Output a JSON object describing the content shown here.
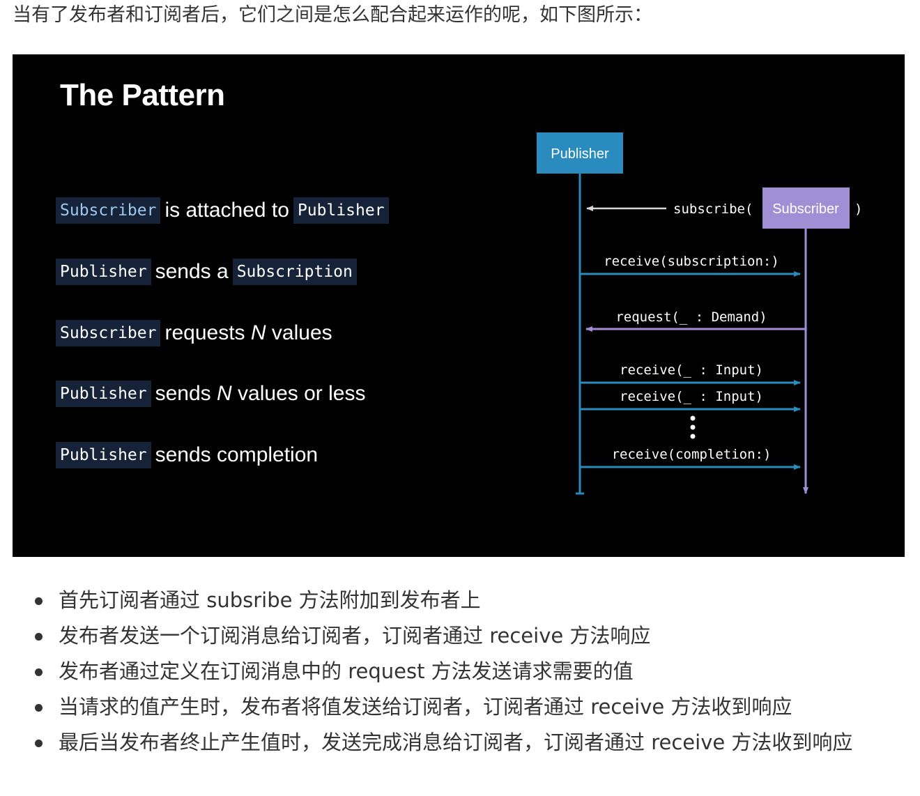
{
  "intro": "当有了发布者和订阅者后，它们之间是怎么配合起来运作的呢，如下图所示：",
  "slide": {
    "title": "The Pattern",
    "steps": [
      {
        "code1": "Subscriber",
        "text": "is attached to",
        "code2": "Publisher"
      },
      {
        "code1": "Publisher",
        "text": "sends a",
        "code2": "Subscription"
      },
      {
        "code1": "Subscriber",
        "text_pre": "requests",
        "text_em": "N",
        "text_post": "values"
      },
      {
        "code1": "Publisher",
        "text_pre": "sends",
        "text_em": "N",
        "text_post": "values or less"
      },
      {
        "code1": "Publisher",
        "text": "sends completion"
      }
    ],
    "diagram": {
      "publisher_label": "Publisher",
      "subscriber_label": "Subscriber",
      "subscribe_open": "subscribe(",
      "subscribe_close": ")",
      "messages": [
        "receive(subscription:)",
        "request(_ : Demand)",
        "receive(_ : Input)",
        "receive(_ : Input)",
        "receive(completion:)"
      ],
      "colors": {
        "publisher": "#2a8bbf",
        "subscriber": "#a08fd4",
        "background": "#000000"
      }
    }
  },
  "bullets": [
    "首先订阅者通过 subsribe 方法附加到发布者上",
    "发布者发送一个订阅消息给订阅者，订阅者通过 receive 方法响应",
    "发布者通过定义在订阅消息中的 request 方法发送请求需要的值",
    "当请求的值产生时，发布者将值发送给订阅者，订阅者通过 receive 方法收到响应",
    "最后当发布者终止产生值时，发送完成消息给订阅者，订阅者通过 receive 方法收到响应"
  ]
}
